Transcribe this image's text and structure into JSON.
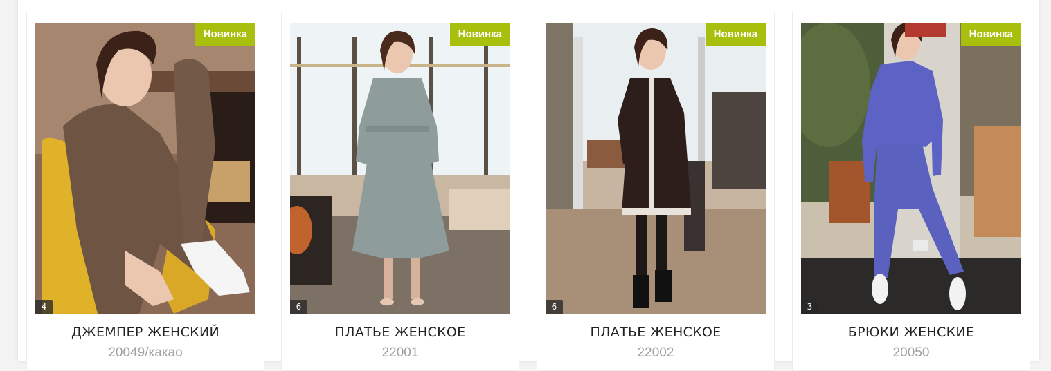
{
  "products": [
    {
      "badge": "Новинка",
      "photo_count": "4",
      "title": "ДЖЕМПЕР ЖЕНСКИЙ",
      "sku": "20049/какао"
    },
    {
      "badge": "Новинка",
      "photo_count": "6",
      "title": "ПЛАТЬЕ ЖЕНСКОЕ",
      "sku": "22001"
    },
    {
      "badge": "Новинка",
      "photo_count": "6",
      "title": "ПЛАТЬЕ ЖЕНСКОЕ",
      "sku": "22002"
    },
    {
      "badge": "Новинка",
      "photo_count": "3",
      "title": "БРЮКИ ЖЕНСКИЕ",
      "sku": "20050"
    }
  ],
  "colors": {
    "badge": "#a9bf0d",
    "title": "#222222",
    "sku": "#a0a0a0"
  }
}
